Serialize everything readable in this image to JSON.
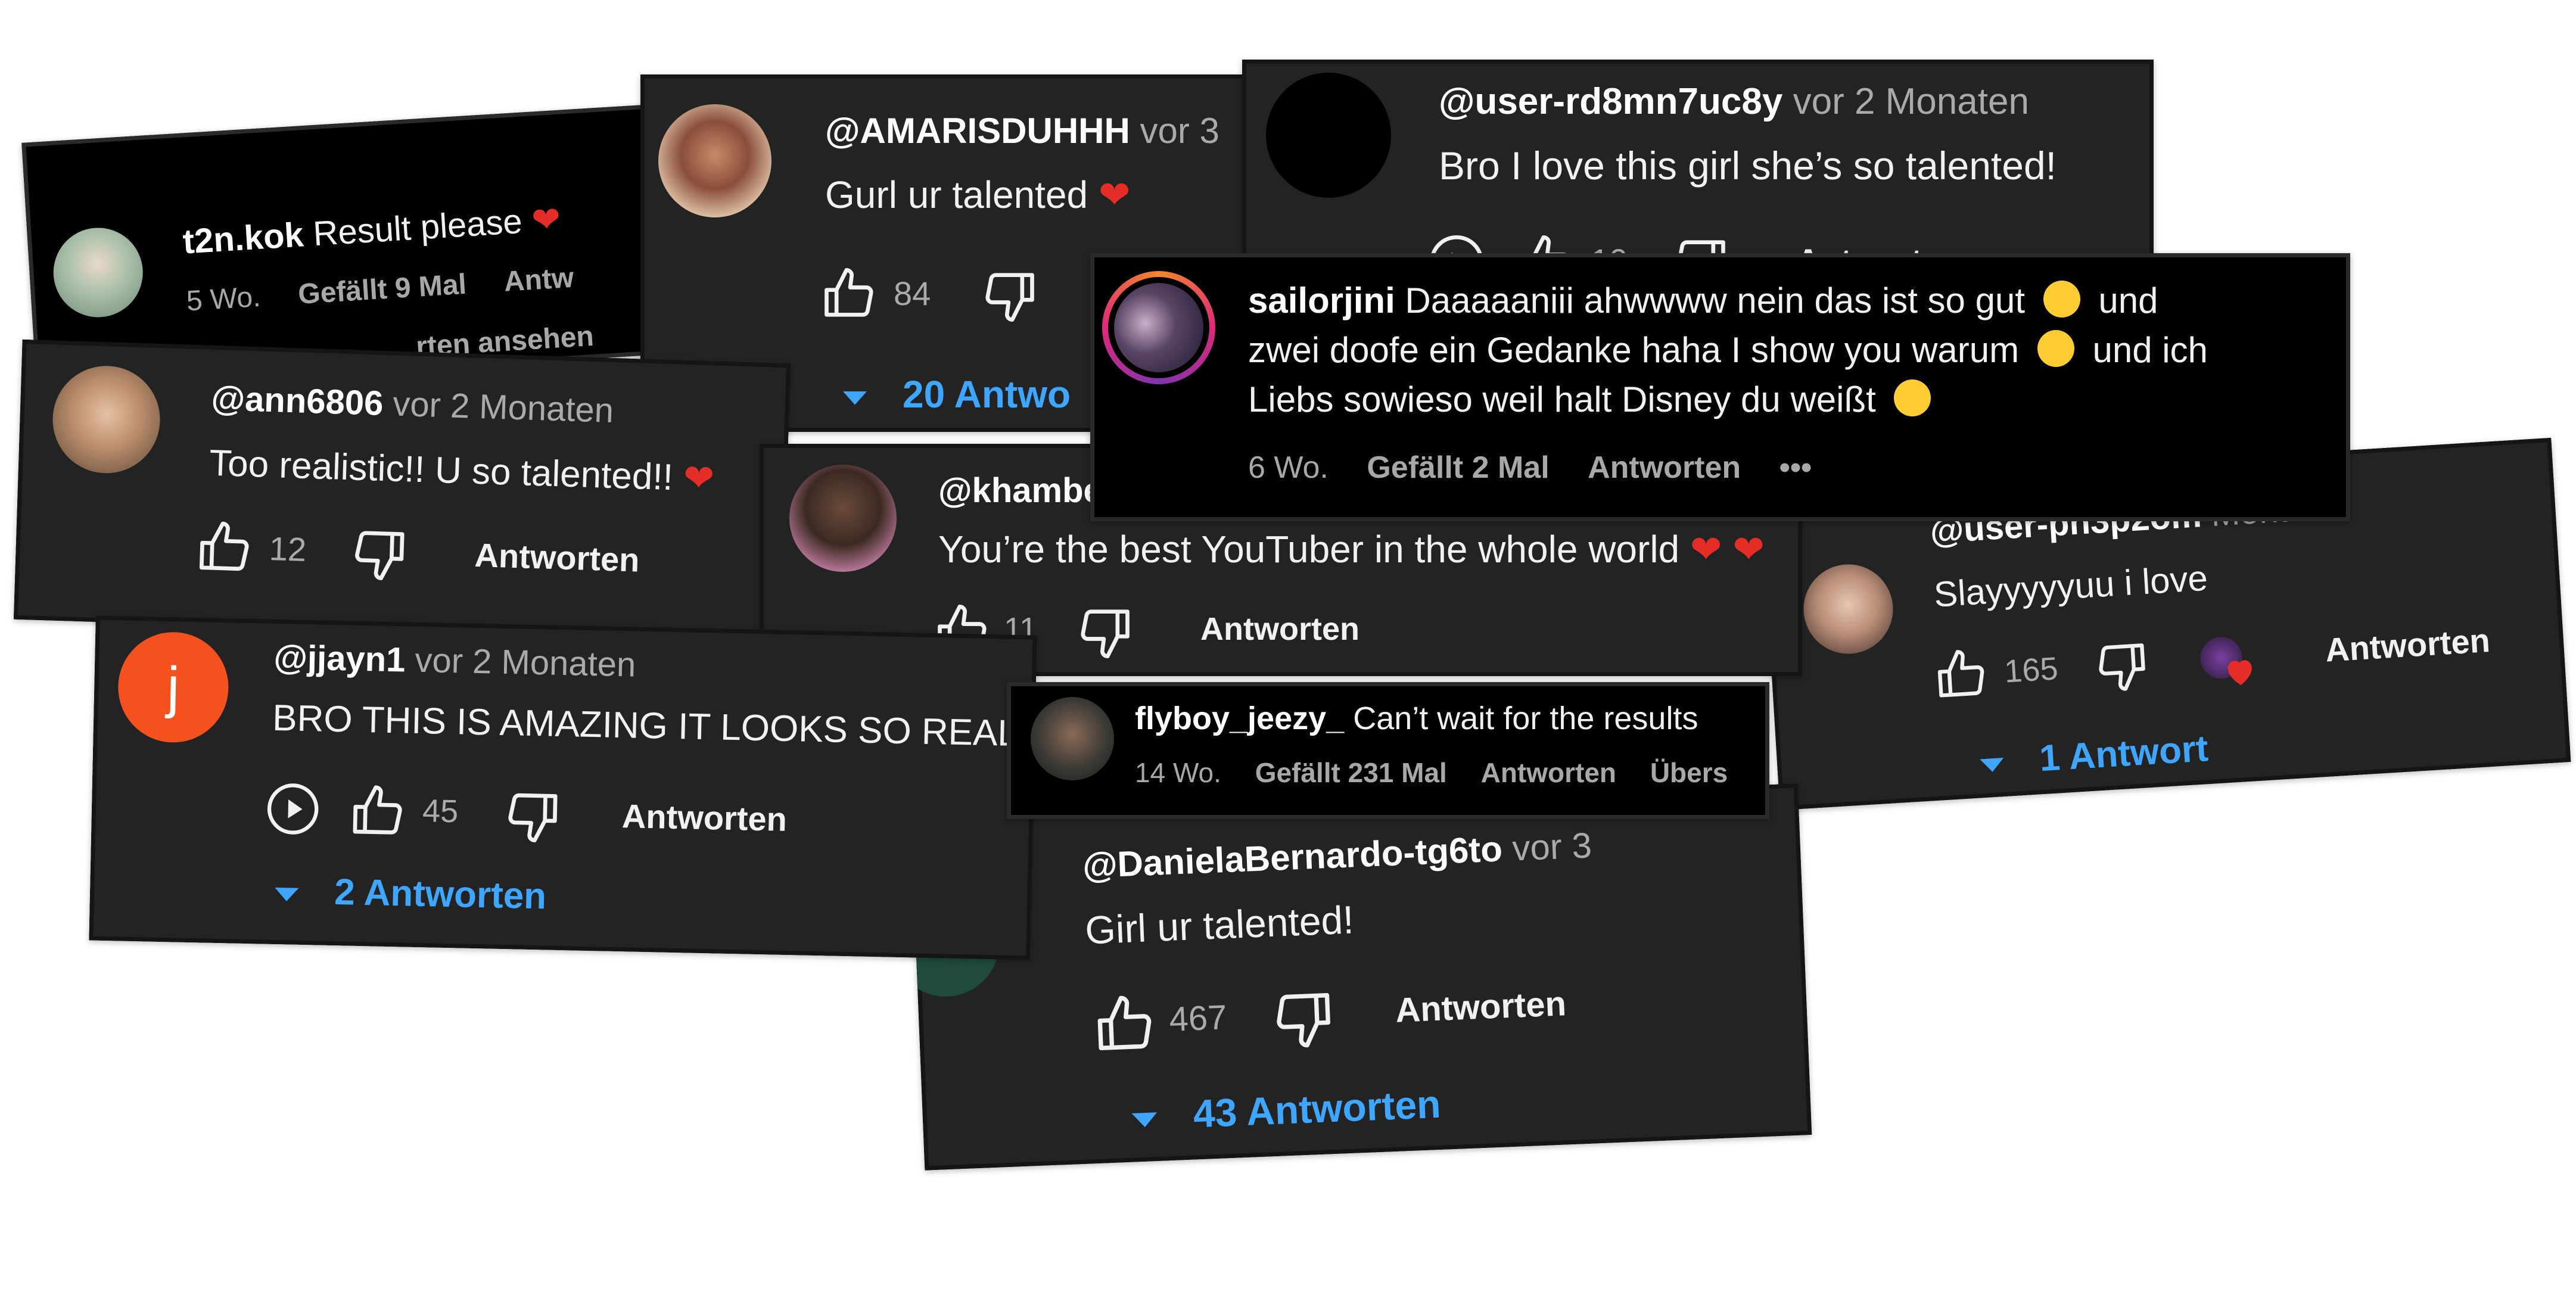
{
  "colors": {
    "card_bg": "#232323",
    "ig_bg": "#000000",
    "reply_link": "#3ea6ff",
    "meta": "#aaaaaa",
    "heart": "#e52d27",
    "avatar_j": "#f4511e"
  },
  "cards": {
    "t2n": {
      "user": "t2n.kok",
      "text": "Result please",
      "age": "5 Wo.",
      "likes": "Gefällt 9 Mal",
      "reply": "Antw",
      "view": "rten ansehen"
    },
    "amaris": {
      "user": "@AMARISDUHHH",
      "age": "vor 3",
      "text": "Gurl ur talented",
      "likes": "84",
      "replies": "20 Antwo"
    },
    "rd8": {
      "user": "@user-rd8mn7uc8y",
      "age": "vor 2 Monaten",
      "text": "Bro I love this girl she’s so talented!",
      "likes": "10",
      "reply": "Antworten"
    },
    "sailor": {
      "user": "sailorjini",
      "line1": "Daaaaaniii ahwwww nein das ist so gut",
      "line1b": "und",
      "line2": "zwei doofe ein Gedanke haha I show you warum",
      "line2b": "und ich",
      "line3": "Liebs sowieso weil halt Disney du weißt",
      "age": "6 Wo.",
      "likes": "Gefällt 2 Mal",
      "reply": "Antworten",
      "more": "•••"
    },
    "ann": {
      "user": "@ann6806",
      "age": "vor 2 Monaten",
      "text": "Too realistic!! U so talented!!",
      "likes": "12",
      "reply": "Antworten"
    },
    "kham": {
      "user": "@khambe",
      "text": "You’re the best YouTuber in the whole world",
      "likes": "11",
      "reply": "Antworten"
    },
    "slay": {
      "user": "@user-pn3p2om",
      "age": "Monaten",
      "text": "Slayyyyyuu i love",
      "likes": "165",
      "reply": "Antworten",
      "replies": "1 Antwort"
    },
    "jjayn": {
      "user": "@jjayn1",
      "age": "vor 2 Monaten",
      "text": "BRO THIS IS AMAZING IT LOOKS SO REAL",
      "avatar_letter": "j",
      "likes": "45",
      "reply": "Antworten",
      "replies": "2 Antworten"
    },
    "flyboy": {
      "user": "flyboy_jeezy_",
      "text": "Can’t wait for the results",
      "age": "14 Wo.",
      "likes": "Gefällt 231 Mal",
      "reply": "Antworten",
      "translate": "Übers"
    },
    "daniela": {
      "user": "@DanielaBernardo-tg6to",
      "age": "vor 3",
      "text": "Girl ur talented!",
      "likes": "467",
      "reply": "Antworten",
      "replies": "43 Antworten"
    }
  }
}
